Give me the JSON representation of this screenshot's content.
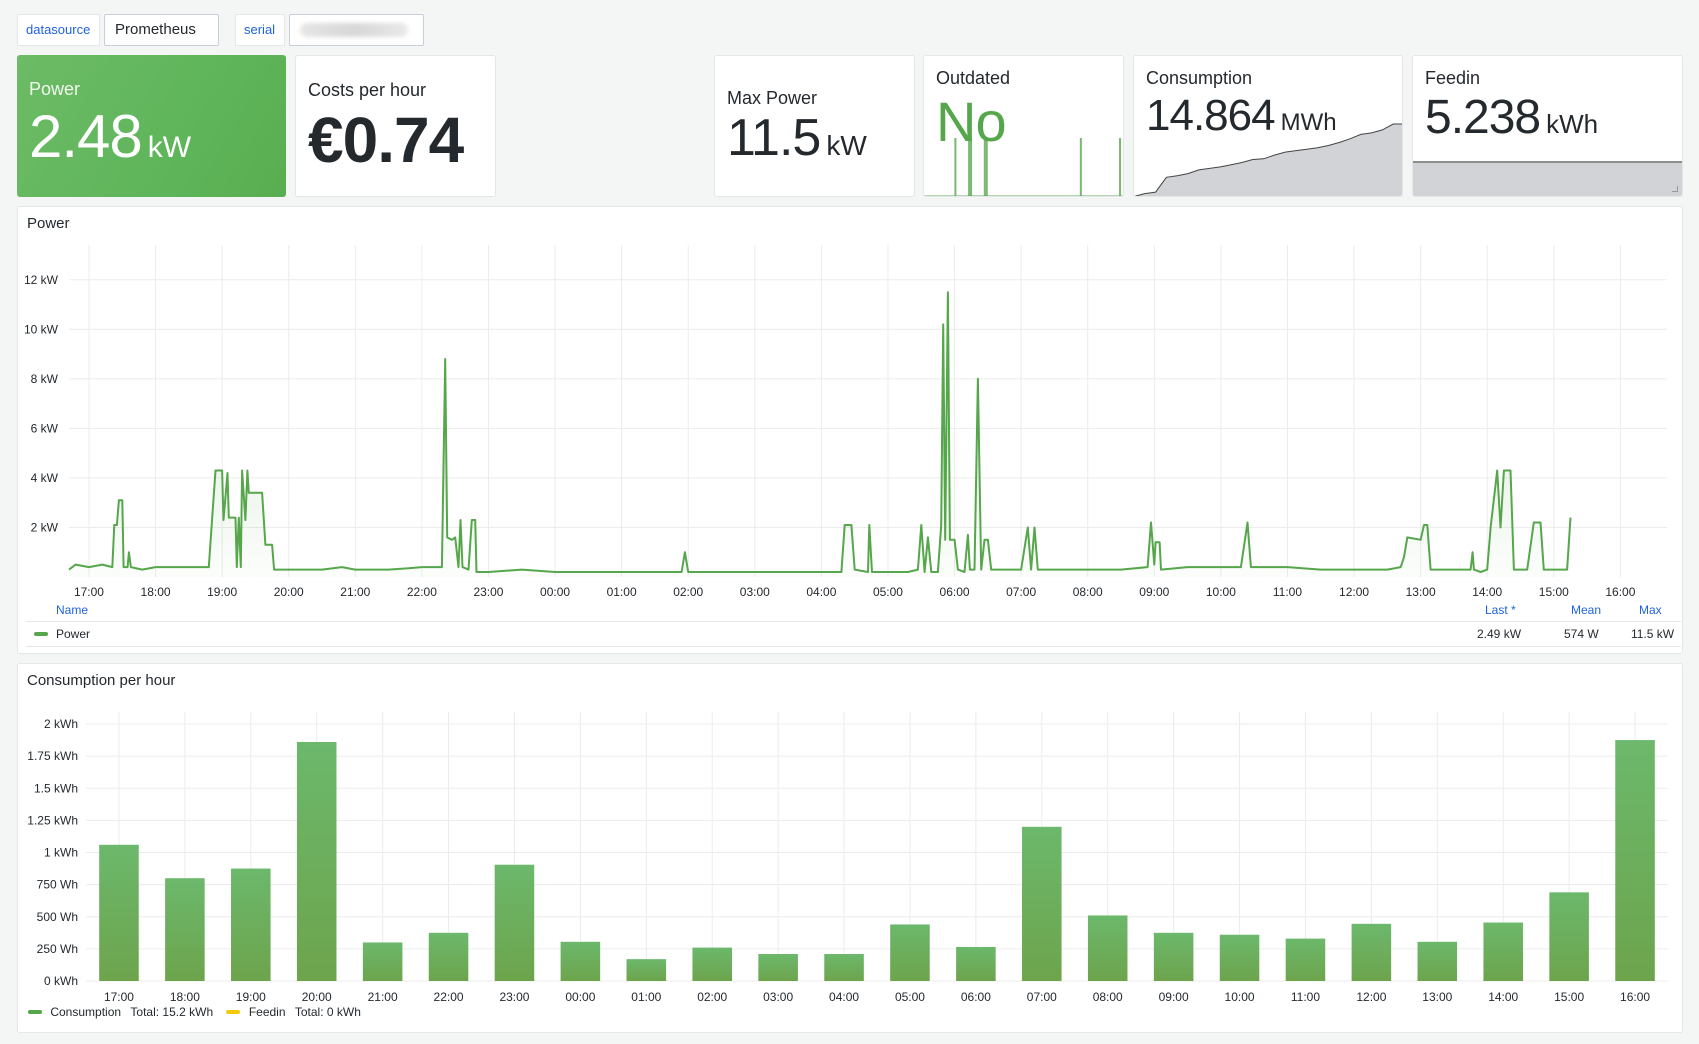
{
  "variables": {
    "datasource_label": "datasource",
    "datasource_value": "Prometheus",
    "serial_label": "serial",
    "serial_value": ""
  },
  "stats": {
    "power": {
      "title": "Power",
      "value": "2.48",
      "unit": "kW",
      "background": "#5fb55a"
    },
    "costs": {
      "title": "Costs per hour",
      "value": "€0.74",
      "unit": ""
    },
    "max_power": {
      "title": "Max Power",
      "value": "11.5",
      "unit": "kW"
    },
    "outdated": {
      "title": "Outdated",
      "value": "No",
      "color": "#56a64b"
    },
    "consumption": {
      "title": "Consumption",
      "value": "14.864",
      "unit": "MWh"
    },
    "feedin": {
      "title": "Feedin",
      "value": "5.238",
      "unit": "kWh"
    }
  },
  "colors": {
    "accent_green": "#56a64b",
    "bar_green": "#6ca852",
    "feedin_yellow": "#f2cc0c",
    "link_blue": "#1f62e0"
  },
  "chart_data": [
    {
      "type": "line",
      "title": "Power",
      "ylabel": "",
      "xlabel": "",
      "ylim": [
        0,
        13
      ],
      "y_ticks": [
        "2 kW",
        "4 kW",
        "6 kW",
        "8 kW",
        "10 kW",
        "12 kW"
      ],
      "y_tick_values": [
        2,
        4,
        6,
        8,
        10,
        12
      ],
      "x_ticks": [
        "17:00",
        "18:00",
        "19:00",
        "20:00",
        "21:00",
        "22:00",
        "23:00",
        "00:00",
        "01:00",
        "02:00",
        "03:00",
        "04:00",
        "05:00",
        "06:00",
        "07:00",
        "08:00",
        "09:00",
        "10:00",
        "11:00",
        "12:00",
        "13:00",
        "14:00",
        "15:00",
        "16:00"
      ],
      "x_range_hours": [
        -0.3,
        23.7
      ],
      "grid": true,
      "series": [
        {
          "name": "Power",
          "color": "#56a64b",
          "unit": "kW",
          "points": [
            [
              -0.3,
              0.3
            ],
            [
              -0.2,
              0.5
            ],
            [
              0,
              0.4
            ],
            [
              0.2,
              0.5
            ],
            [
              0.35,
              0.4
            ],
            [
              0.38,
              2.1
            ],
            [
              0.42,
              2.1
            ],
            [
              0.45,
              3.1
            ],
            [
              0.5,
              3.1
            ],
            [
              0.52,
              0.4
            ],
            [
              0.58,
              0.4
            ],
            [
              0.6,
              1.0
            ],
            [
              0.63,
              0.4
            ],
            [
              0.8,
              0.3
            ],
            [
              1.0,
              0.4
            ],
            [
              1.5,
              0.4
            ],
            [
              1.8,
              0.4
            ],
            [
              1.85,
              2.4
            ],
            [
              1.9,
              4.3
            ],
            [
              2.0,
              4.3
            ],
            [
              2.02,
              2.3
            ],
            [
              2.08,
              4.2
            ],
            [
              2.1,
              2.4
            ],
            [
              2.2,
              2.4
            ],
            [
              2.22,
              0.4
            ],
            [
              2.25,
              2.4
            ],
            [
              2.28,
              0.4
            ],
            [
              2.3,
              4.3
            ],
            [
              2.35,
              2.3
            ],
            [
              2.38,
              4.3
            ],
            [
              2.4,
              3.4
            ],
            [
              2.6,
              3.4
            ],
            [
              2.65,
              1.3
            ],
            [
              2.75,
              1.3
            ],
            [
              2.78,
              0.3
            ],
            [
              3.0,
              0.3
            ],
            [
              3.5,
              0.3
            ],
            [
              3.8,
              0.4
            ],
            [
              4.0,
              0.3
            ],
            [
              4.5,
              0.3
            ],
            [
              4.8,
              0.35
            ],
            [
              5.0,
              0.4
            ],
            [
              5.2,
              0.4
            ],
            [
              5.3,
              0.4
            ],
            [
              5.35,
              8.8
            ],
            [
              5.38,
              1.6
            ],
            [
              5.45,
              1.5
            ],
            [
              5.5,
              1.6
            ],
            [
              5.55,
              0.4
            ],
            [
              5.58,
              2.3
            ],
            [
              5.61,
              0.4
            ],
            [
              5.7,
              0.3
            ],
            [
              5.75,
              2.3
            ],
            [
              5.8,
              2.3
            ],
            [
              5.82,
              0.2
            ],
            [
              6.0,
              0.2
            ],
            [
              6.5,
              0.3
            ],
            [
              7.0,
              0.2
            ],
            [
              7.5,
              0.2
            ],
            [
              8.0,
              0.2
            ],
            [
              8.5,
              0.2
            ],
            [
              8.9,
              0.2
            ],
            [
              8.95,
              1.0
            ],
            [
              9.0,
              0.2
            ],
            [
              9.5,
              0.2
            ],
            [
              10.0,
              0.2
            ],
            [
              10.5,
              0.2
            ],
            [
              11.0,
              0.2
            ],
            [
              11.3,
              0.2
            ],
            [
              11.35,
              2.1
            ],
            [
              11.45,
              2.1
            ],
            [
              11.5,
              0.3
            ],
            [
              11.7,
              0.2
            ],
            [
              11.72,
              2.1
            ],
            [
              11.76,
              0.2
            ],
            [
              12.0,
              0.2
            ],
            [
              12.3,
              0.2
            ],
            [
              12.45,
              0.3
            ],
            [
              12.5,
              2.1
            ],
            [
              12.55,
              0.2
            ],
            [
              12.6,
              1.6
            ],
            [
              12.65,
              0.2
            ],
            [
              12.75,
              0.2
            ],
            [
              12.8,
              2.1
            ],
            [
              12.83,
              10.2
            ],
            [
              12.86,
              1.5
            ],
            [
              12.9,
              11.5
            ],
            [
              12.93,
              1.5
            ],
            [
              13.0,
              1.5
            ],
            [
              13.05,
              0.3
            ],
            [
              13.15,
              0.2
            ],
            [
              13.2,
              1.7
            ],
            [
              13.23,
              0.3
            ],
            [
              13.3,
              0.3
            ],
            [
              13.35,
              8.0
            ],
            [
              13.4,
              0.3
            ],
            [
              13.45,
              1.5
            ],
            [
              13.5,
              1.5
            ],
            [
              13.55,
              0.3
            ],
            [
              13.8,
              0.3
            ],
            [
              14.0,
              0.3
            ],
            [
              14.1,
              2.0
            ],
            [
              14.15,
              0.3
            ],
            [
              14.2,
              2.0
            ],
            [
              14.25,
              0.3
            ],
            [
              14.5,
              0.3
            ],
            [
              15.0,
              0.3
            ],
            [
              15.5,
              0.3
            ],
            [
              15.9,
              0.4
            ],
            [
              15.95,
              2.2
            ],
            [
              16.0,
              0.5
            ],
            [
              16.02,
              1.4
            ],
            [
              16.08,
              1.4
            ],
            [
              16.1,
              0.3
            ],
            [
              16.5,
              0.4
            ],
            [
              16.8,
              0.4
            ],
            [
              17.3,
              0.4
            ],
            [
              17.4,
              2.2
            ],
            [
              17.45,
              0.4
            ],
            [
              18.0,
              0.4
            ],
            [
              18.5,
              0.3
            ],
            [
              19.0,
              0.3
            ],
            [
              19.5,
              0.3
            ],
            [
              19.7,
              0.4
            ],
            [
              19.75,
              0.8
            ],
            [
              19.8,
              1.6
            ],
            [
              20.0,
              1.5
            ],
            [
              20.05,
              2.1
            ],
            [
              20.1,
              2.1
            ],
            [
              20.15,
              0.3
            ],
            [
              20.5,
              0.3
            ],
            [
              20.75,
              0.3
            ],
            [
              20.78,
              1.0
            ],
            [
              20.8,
              0.3
            ],
            [
              20.9,
              0.2
            ],
            [
              21.0,
              0.3
            ],
            [
              21.05,
              2.0
            ],
            [
              21.15,
              4.3
            ],
            [
              21.2,
              2.0
            ],
            [
              21.25,
              4.3
            ],
            [
              21.35,
              4.3
            ],
            [
              21.4,
              0.3
            ],
            [
              21.6,
              0.3
            ],
            [
              21.7,
              2.2
            ],
            [
              21.8,
              2.2
            ],
            [
              21.85,
              0.3
            ],
            [
              22.2,
              0.3
            ],
            [
              22.25,
              2.4
            ]
          ]
        }
      ],
      "legend": {
        "placement": "bottom",
        "headers": {
          "name": "Name",
          "last": "Last *",
          "mean": "Mean",
          "max": "Max"
        },
        "rows": [
          {
            "name": "Power",
            "last": "2.49 kW",
            "mean": "574 W",
            "max": "11.5 kW"
          }
        ]
      }
    },
    {
      "type": "bar",
      "title": "Consumption per hour",
      "xlabel": "",
      "ylabel": "",
      "ylim": [
        0,
        2.1
      ],
      "y_ticks": [
        "0 kWh",
        "250 Wh",
        "500 Wh",
        "750 Wh",
        "1 kWh",
        "1.25 kWh",
        "1.5 kWh",
        "1.75 kWh",
        "2 kWh"
      ],
      "y_tick_values": [
        0,
        0.25,
        0.5,
        0.75,
        1,
        1.25,
        1.5,
        1.75,
        2
      ],
      "categories": [
        "17:00",
        "18:00",
        "19:00",
        "20:00",
        "21:00",
        "22:00",
        "23:00",
        "00:00",
        "01:00",
        "02:00",
        "03:00",
        "04:00",
        "05:00",
        "06:00",
        "07:00",
        "08:00",
        "09:00",
        "10:00",
        "11:00",
        "12:00",
        "13:00",
        "14:00",
        "15:00",
        "16:00"
      ],
      "grid": true,
      "series": [
        {
          "name": "Consumption",
          "color": "#6ca852",
          "unit": "kWh",
          "values": [
            1.06,
            0.8,
            0.875,
            1.86,
            0.3,
            0.375,
            0.905,
            0.305,
            0.17,
            0.26,
            0.21,
            0.21,
            0.44,
            0.265,
            1.2,
            0.51,
            0.375,
            0.36,
            0.33,
            0.445,
            0.305,
            0.455,
            0.69,
            1.875
          ],
          "total": "Total: 15.2 kWh"
        },
        {
          "name": "Feedin",
          "color": "#f2cc0c",
          "unit": "kWh",
          "values": [
            0,
            0,
            0,
            0,
            0,
            0,
            0,
            0,
            0,
            0,
            0,
            0,
            0,
            0,
            0,
            0,
            0,
            0,
            0,
            0,
            0,
            0,
            0,
            0
          ],
          "total": "Total: 0 kWh"
        }
      ],
      "legend": {
        "placement": "bottom-left"
      }
    }
  ],
  "sparklines": {
    "outdated_spikes_fraction": [
      0.15,
      0.22,
      0.23,
      0.3,
      0.31,
      0.79,
      0.99
    ],
    "consumption_cumulative": [
      0.02,
      0.06,
      0.08,
      0.28,
      0.3,
      0.33,
      0.38,
      0.4,
      0.42,
      0.45,
      0.48,
      0.52,
      0.53,
      0.58,
      0.62,
      0.64,
      0.66,
      0.68,
      0.71,
      0.75,
      0.8,
      0.86,
      0.88,
      0.92,
      1.0,
      1.0
    ],
    "feedin_level_fraction": 0.72
  }
}
